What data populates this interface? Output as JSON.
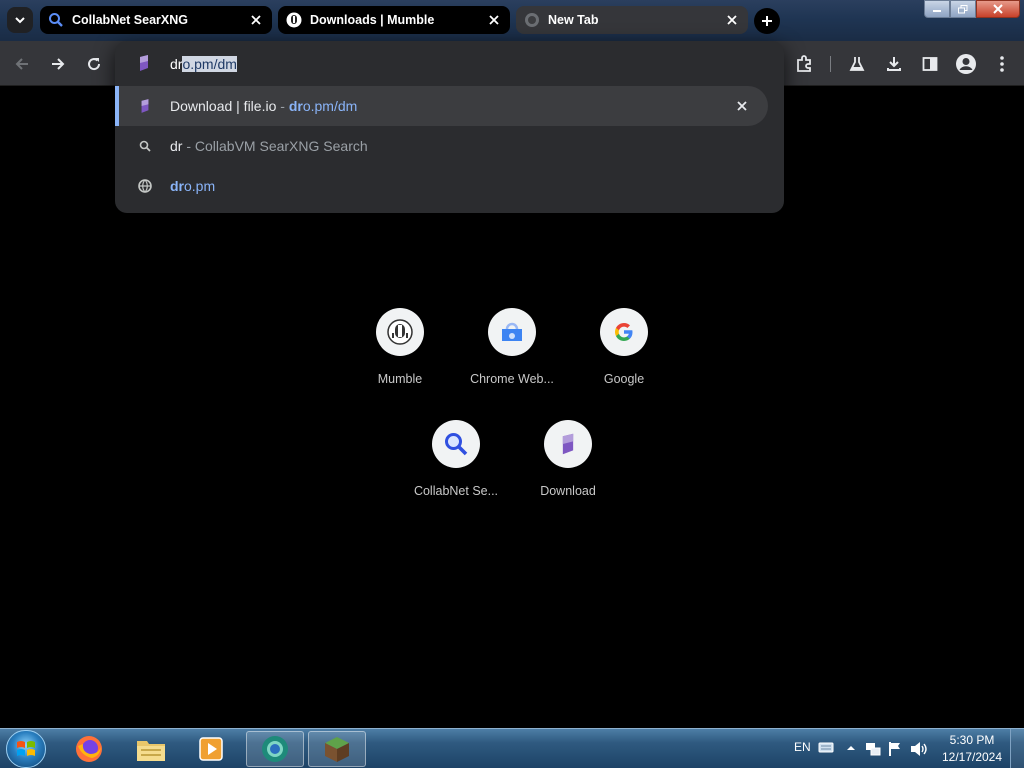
{
  "tabs": [
    {
      "title": "CollabNet SearXNG",
      "icon": "search-icon",
      "active": false
    },
    {
      "title": "Downloads | Mumble",
      "icon": "mumble-icon",
      "active": false
    },
    {
      "title": "New Tab",
      "icon": "globe-icon",
      "active": true
    }
  ],
  "omnibox": {
    "typed": "dr",
    "autocomplete": "o.pm/dm"
  },
  "suggestions": [
    {
      "title": "Download | file.io",
      "sep": " - ",
      "url_match": "dr",
      "url_rest": "o.pm/dm",
      "icon": "fileio-icon",
      "selected": true
    },
    {
      "query": "dr",
      "sep": " - ",
      "desc": "CollabVM SearXNG Search",
      "icon": "search-icon"
    },
    {
      "url_match": "dr",
      "url_rest": "o.pm",
      "icon": "globe-icon"
    }
  ],
  "shortcuts": [
    {
      "label": "Mumble",
      "icon": "mumble-icon"
    },
    {
      "label": "Chrome Web...",
      "icon": "chrome-web-store-icon"
    },
    {
      "label": "Google",
      "icon": "google-icon"
    },
    {
      "label": "CollabNet Se...",
      "icon": "search-icon"
    },
    {
      "label": "Download",
      "icon": "fileio-icon"
    }
  ],
  "taskbar": {
    "language": "EN",
    "time": "5:30 PM",
    "date": "12/17/2024",
    "apps": [
      "firefox-icon",
      "file-explorer-icon",
      "media-player-icon",
      "chrome-icon",
      "minecraft-icon"
    ]
  },
  "colors": {
    "accent": "#8ab4f8",
    "toolbar": "#35363a",
    "dropdown": "#2b2c2f"
  }
}
